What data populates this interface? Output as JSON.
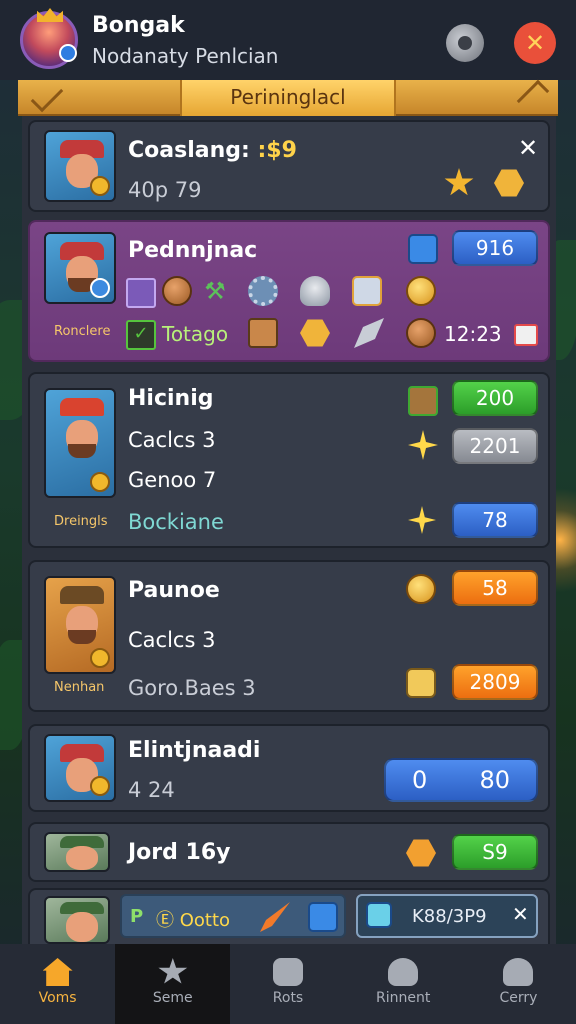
{
  "header": {
    "title": "Bongak",
    "subtitle": "Nodanaty Penlcian",
    "settings_icon": "settings-icon",
    "close_icon": "close-icon",
    "close_glyph": "✕"
  },
  "banner": {
    "label": "Perininglacl"
  },
  "cards": [
    {
      "title": "Coaslang:",
      "title_value": ":$9",
      "subtitle": "40p 79",
      "close_glyph": "✕"
    },
    {
      "title": "Pednnjnac",
      "badge_value": "916",
      "hero_label": "Ronclere",
      "reward_label": "Totago",
      "time": "12:23"
    },
    {
      "title": "Hicinig",
      "line1": "Caclcs 3",
      "line2": "Genoo 7",
      "accent_line": "Bockiane",
      "hero_label": "Dreingls",
      "value1": "200",
      "value2": "2201",
      "value3": "78"
    },
    {
      "title": "Paunoe",
      "line1": "Caclcs 3",
      "line2": "Goro.Baes 3",
      "hero_label": "Nenhan",
      "value1": "58",
      "value2": "2809"
    },
    {
      "title": "Elintjnaadi",
      "subtitle": "4 24",
      "value_left": "0",
      "value_right": "80"
    },
    {
      "title": "Jord 16y",
      "value": "S9"
    },
    {
      "sub_left": "P",
      "sub_label": "Ⓔ Ootto",
      "sub_right": "K88/3P9",
      "close_glyph": "✕"
    }
  ],
  "nav": [
    {
      "label": "Voms",
      "icon": "home-icon",
      "active": true
    },
    {
      "label": "Seme",
      "icon": "star-icon"
    },
    {
      "label": "Rots",
      "icon": "camera-icon"
    },
    {
      "label": "Rinnent",
      "icon": "group-icon"
    },
    {
      "label": "Cerry",
      "icon": "profile-icon"
    }
  ]
}
